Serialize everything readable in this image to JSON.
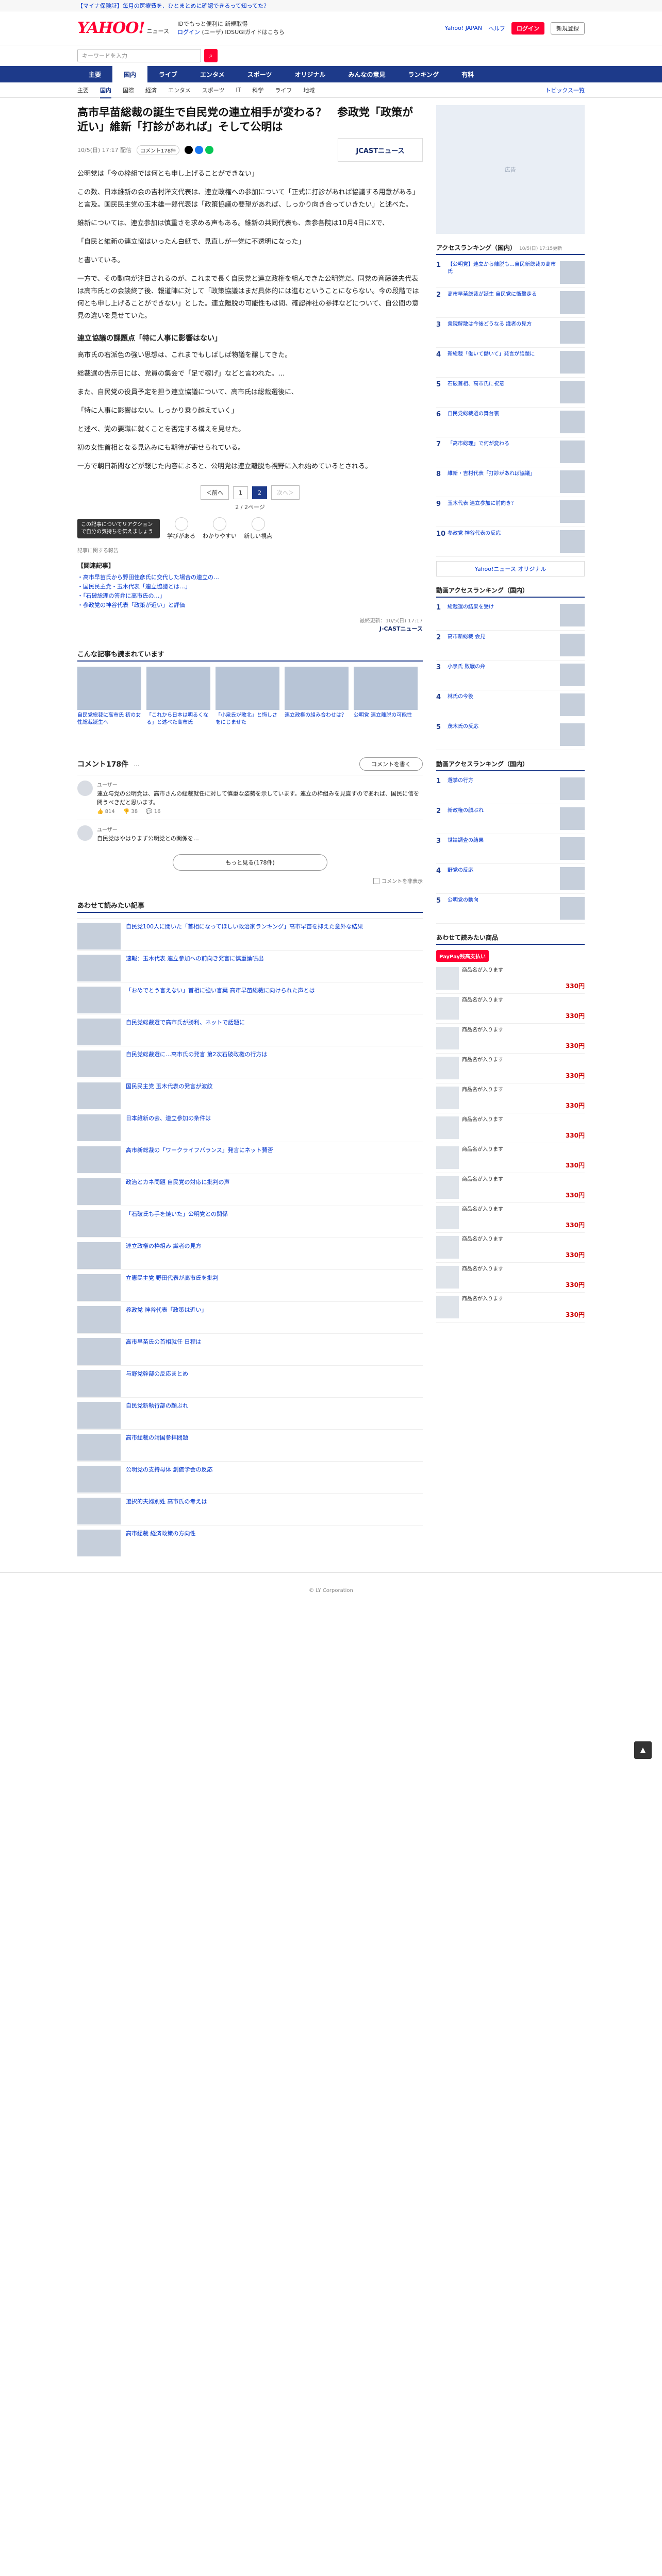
{
  "promo": "【マイナ保険証】毎月の医療費を、ひとまとめに確認できるって知ってた？",
  "header": {
    "logo_main": "YAHOO!",
    "logo_sub": "ニュース",
    "link1": "IDでもっと便利に 新規取得",
    "link2": "ログイン",
    "link3": "(ユーザ) IDSUGIガイドはこちら",
    "right": [
      "Yahoo! JAPAN",
      "ヘルプ"
    ],
    "login": "ログイン",
    "register": "新規登録"
  },
  "search": {
    "placeholder": "キーワードを入力",
    "button": "検索"
  },
  "nav": {
    "items": [
      "主要",
      "国内",
      "ライブ",
      "エンタメ",
      "スポーツ",
      "オリジナル",
      "みんなの意見",
      "ランキング",
      "有料"
    ],
    "active": 1
  },
  "subnav": {
    "items": [
      "主要",
      "国内",
      "国際",
      "経済",
      "エンタメ",
      "スポーツ",
      "IT",
      "科学",
      "ライフ",
      "地域"
    ],
    "active": 1,
    "right": "トピックス一覧"
  },
  "article": {
    "headline": "高市早苗総裁の誕生で自民党の連立相手が変わる？　参政党「政策が近い」維新「打診があれば」そして公明は",
    "date": "10/5(日) 17:17 配信",
    "comments_pill": "コメント178件",
    "source": "JCASTニュース",
    "paragraphs": [
      "公明党は「今の枠組では何とも申し上げることができない」",
      "この数、日本維新の会の吉村洋文代表は、連立政権への参加について「正式に打診があれば協議する用意がある」と言及。国民民主党の玉木雄一郎代表は「政策協議の要望があれば、しっかり向き合っていきたい」と述べた。",
      "維新については、連立参加は慎重さを求める声もある。維新の共同代表も、衆参各院は10月4日にXで、",
      "「自民と維新の連立協はいったん白紙で、見直しが一党に不透明になった」",
      "と書いている。",
      "一方で、その動向が注目されるのが、これまで長く自民党と連立政権を組んできた公明党だ。同党の斉藤鉄夫代表は高市氏との会談終了後、報道陣に対して「政策協議はまだ具体的には進むということにならない。今の段階では何とも申し上げることができない」とした。連立離脱の可能性もは問、確認神社の参拝などについて、自公間の意見の違いを見せていた。"
    ],
    "subhead": "連立協議の課題点「特に人事に影響はない」",
    "paragraphs2": [
      "高市氏の右派色の強い思想は、これまでもしばしば物議を醸してきた。",
      "総裁選の告示日には、党員の集会で「足で稼げ」などと言われた。…",
      "また、自民党の役員予定を担う連立協議について、高市氏は総裁選後に、",
      "「特に人事に影響はない。しっかり乗り越えていく」",
      "と述べ、党の要職に就くことを否定する構えを見せた。",
      "初の女性首相となる見込みにも期待が寄せられている。",
      "一方で朝日新聞などが報じた内容によると、公明党は連立離脱も視野に入れ始めているとされる。"
    ],
    "pager": {
      "pages": [
        "1",
        "2"
      ],
      "prev": "＜前へ",
      "next": "次へ＞",
      "caption": "2 / 2ページ"
    },
    "tooltip": "この記事についてリアクションで自分の気持ちを伝えましょう",
    "reactions": [
      "学びがある",
      "わかりやすい",
      "新しい視点"
    ],
    "note": "記事に関する報告",
    "related_title": "【関連記事】",
    "related": [
      "・高市早苗氏から野田佳彦氏に交代した場合の連立の…",
      "・国民民主党・玉木代表「連立協議とは…」",
      "・「石破総理の答弁に高市氏の…」",
      "・参政党の神谷代表「政策が近い」と評価"
    ],
    "copyright": "最終更新：10/5(日) 17:17",
    "copy_source": "J-CASTニュース"
  },
  "cards_title": "こんな記事も読まれています",
  "cards": [
    {
      "caption": "自民党総裁に高市氏 初の女性総裁誕生へ"
    },
    {
      "caption": "「これから日本は明るくなる」と述べた高市氏"
    },
    {
      "caption": "「小泉氏が敗北」と悔しさをにじませた"
    },
    {
      "caption": "連立政権の組み合わせは？"
    },
    {
      "caption": "公明党 連立離脱の可能性"
    }
  ],
  "comments": {
    "title": "コメント178件",
    "hint": "…",
    "post": "コメントを書く",
    "items": [
      {
        "user": "ユーザー",
        "text": "連立与党の公明党は、高市さんの総裁就任に対して慎重な姿勢を示しています。連立の枠組みを見直すのであれば、国民に信を問うべきだと思います。",
        "likes": "814",
        "dislikes": "38",
        "replies": "16"
      },
      {
        "user": "ユーザー",
        "text": "自民党はやはりまず公明党との関係を…",
        "likes": "",
        "dislikes": "",
        "replies": ""
      }
    ],
    "more": "もっと見る(178件)",
    "hide_label": "コメントを非表示"
  },
  "recommend_title": "あわせて読みたい記事",
  "recommend": [
    "自民党100人に聞いた「首相になってほしい政治家ランキング」高市早苗を抑えた意外な結果",
    "速報：玉木代表 連立参加への前向き発言に慎重論噴出",
    "「おめでとう言えない」首相に強い言葉 高市早苗総裁に向けられた声とは",
    "自民党総裁選で高市氏が勝利、ネットで話題に",
    "自民党総裁選に…高市氏の発言 第2次石破政権の行方は",
    "国民民主党 玉木代表の発言が波紋",
    "日本維新の会、連立参加の条件は",
    "高市新総裁の「ワークライフバランス」発言にネット賛否",
    "政治とカネ問題 自民党の対応に批判の声",
    "「石破氏も手を焼いた」公明党との関係",
    "連立政権の枠組み 識者の見方",
    "立憲民主党 野田代表が高市氏を批判",
    "参政党 神谷代表「政策は近い」",
    "高市早苗氏の首相就任 日程は",
    "与野党幹部の反応まとめ",
    "自民党新執行部の顔ぶれ",
    "高市総裁の靖国参拝問題",
    "公明党の支持母体 創価学会の反応",
    "選択的夫婦別姓 高市氏の考えは",
    "高市総裁 経済政策の方向性"
  ],
  "recommend2_title": "あわせて読みたい記事",
  "sidebar": {
    "ad": "広告",
    "access_title": "アクセスランキング（国内）",
    "access_updated": "10/5(日) 17:15更新",
    "access": [
      "【公明党】連立から離脱も…自民新総裁の高市氏",
      "高市早苗総裁が誕生 自民党に衝撃走る",
      "衆院解散は今後どうなる 識者の見方",
      "新総裁「働いて働いて」発言が話題に",
      "石破首相、高市氏に祝意",
      "自民党総裁選の舞台裏",
      "「高市総理」で何が変わる",
      "維新・吉村代表「打診があれば協議」",
      "玉木代表 連立参加に前向き？",
      "参政党 神谷代表の反応"
    ],
    "yahoo_orig": "Yahoo!ニュース オリジナル",
    "comment_title": "動画アクセスランキング（国内）",
    "comment": [
      "総裁選の結果を受け",
      "高市新総裁 会見",
      "小泉氏 敗戦の弁",
      "林氏の今後",
      "茂木氏の反応"
    ],
    "comment2_title": "動画アクセスランキング（国内）",
    "comment2": [
      "選挙の行方",
      "新政権の顔ぶれ",
      "世論調査の結果",
      "野党の反応",
      "公明党の動向"
    ],
    "shop_title": "あわせて読みたい商品",
    "paypay": "PayPay残高支払い",
    "shop": [
      {
        "name": "商品名が入ります",
        "price": "330円"
      },
      {
        "name": "商品名が入ります",
        "price": "330円"
      },
      {
        "name": "商品名が入ります",
        "price": "330円"
      },
      {
        "name": "商品名が入ります",
        "price": "330円"
      },
      {
        "name": "商品名が入ります",
        "price": "330円"
      },
      {
        "name": "商品名が入ります",
        "price": "330円"
      },
      {
        "name": "商品名が入ります",
        "price": "330円"
      },
      {
        "name": "商品名が入ります",
        "price": "330円"
      },
      {
        "name": "商品名が入ります",
        "price": "330円"
      },
      {
        "name": "商品名が入ります",
        "price": "330円"
      },
      {
        "name": "商品名が入ります",
        "price": "330円"
      },
      {
        "name": "商品名が入ります",
        "price": "330円"
      }
    ]
  },
  "footer": "© LY Corporation"
}
